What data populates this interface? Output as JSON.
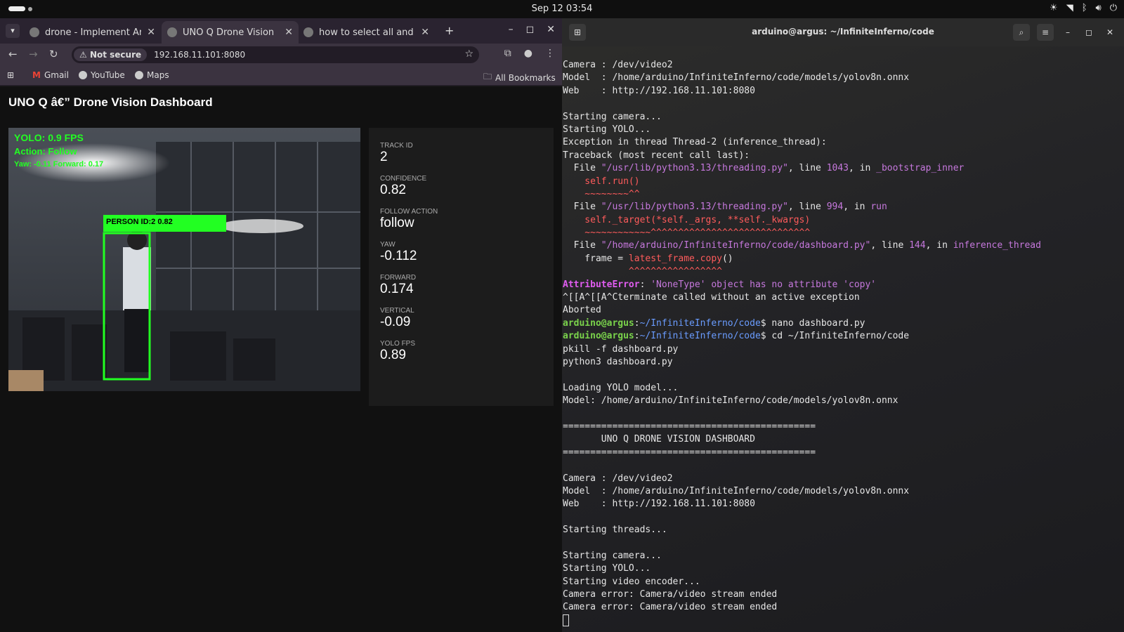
{
  "system": {
    "clock": "Sep 12  03:54"
  },
  "browser": {
    "tabs": [
      {
        "title": "drone - Implement Ardui",
        "active": false
      },
      {
        "title": "UNO Q Drone Vision",
        "active": true
      },
      {
        "title": "how to select all and del",
        "active": false
      }
    ],
    "security_label": "Not secure",
    "url": "192.168.11.101:8080",
    "bookmarks": [
      "Gmail",
      "YouTube",
      "Maps"
    ],
    "all_bookmarks": "All Bookmarks"
  },
  "dashboard": {
    "title": "UNO Q â€” Drone Vision Dashboard",
    "overlay": {
      "fps": "YOLO: 0.9 FPS",
      "action": "Action: Follow",
      "yaw_forward": "Yaw: -0.11  Forward: 0.17",
      "detection_label": "PERSON  ID:2  0.82"
    },
    "stats": [
      {
        "label": "TRACK ID",
        "value": "2"
      },
      {
        "label": "CONFIDENCE",
        "value": "0.82"
      },
      {
        "label": "FOLLOW ACTION",
        "value": "follow"
      },
      {
        "label": "YAW",
        "value": "-0.112"
      },
      {
        "label": "FORWARD",
        "value": "0.174"
      },
      {
        "label": "VERTICAL",
        "value": "-0.09"
      },
      {
        "label": "YOLO FPS",
        "value": "0.89"
      }
    ]
  },
  "terminal": {
    "title": "arduino@argus: ~/InfiniteInferno/code",
    "lines": [
      {
        "segments": [
          {
            "text": "Camera : /dev/video2"
          }
        ]
      },
      {
        "segments": [
          {
            "text": "Model  : /home/arduino/InfiniteInferno/code/models/yolov8n.onnx"
          }
        ]
      },
      {
        "segments": [
          {
            "text": "Web    : http://192.168.11.101:8080"
          }
        ]
      },
      {
        "segments": [
          {
            "text": ""
          }
        ]
      },
      {
        "segments": [
          {
            "text": "Starting camera..."
          }
        ]
      },
      {
        "segments": [
          {
            "text": "Starting YOLO..."
          }
        ]
      },
      {
        "segments": [
          {
            "text": "Exception in thread Thread-2 (inference_thread):"
          }
        ]
      },
      {
        "segments": [
          {
            "text": "Traceback (most recent call last):"
          }
        ]
      },
      {
        "segments": [
          {
            "text": "  File "
          },
          {
            "text": "\"/usr/lib/python3.13/threading.py\"",
            "cls": "mag"
          },
          {
            "text": ", line "
          },
          {
            "text": "1043",
            "cls": "mag"
          },
          {
            "text": ", in "
          },
          {
            "text": "_bootstrap_inner",
            "cls": "mag"
          }
        ]
      },
      {
        "segments": [
          {
            "text": "    self.run()",
            "cls": "red"
          }
        ]
      },
      {
        "segments": [
          {
            "text": "    ~~~~~~~~^^",
            "cls": "red"
          }
        ]
      },
      {
        "segments": [
          {
            "text": "  File "
          },
          {
            "text": "\"/usr/lib/python3.13/threading.py\"",
            "cls": "mag"
          },
          {
            "text": ", line "
          },
          {
            "text": "994",
            "cls": "mag"
          },
          {
            "text": ", in "
          },
          {
            "text": "run",
            "cls": "mag"
          }
        ]
      },
      {
        "segments": [
          {
            "text": "    self._target(*self._args, **self._kwargs)",
            "cls": "red"
          }
        ]
      },
      {
        "segments": [
          {
            "text": "    ~~~~~~~~~~~~^^^^^^^^^^^^^^^^^^^^^^^^^^^^^",
            "cls": "red"
          }
        ]
      },
      {
        "segments": [
          {
            "text": "  File "
          },
          {
            "text": "\"/home/arduino/InfiniteInferno/code/dashboard.py\"",
            "cls": "mag"
          },
          {
            "text": ", line "
          },
          {
            "text": "144",
            "cls": "mag"
          },
          {
            "text": ", in "
          },
          {
            "text": "inference_thread",
            "cls": "mag"
          }
        ]
      },
      {
        "segments": [
          {
            "text": "    frame = "
          },
          {
            "text": "latest_frame.copy",
            "cls": "red"
          },
          {
            "text": "()"
          }
        ]
      },
      {
        "segments": [
          {
            "text": "            ^^^^^^^^^^^^^^^^^",
            "cls": "red"
          }
        ]
      },
      {
        "segments": [
          {
            "text": "AttributeError",
            "cls": "err"
          },
          {
            "text": ": "
          },
          {
            "text": "'NoneType' object has no attribute 'copy'",
            "cls": "mag"
          }
        ]
      },
      {
        "segments": [
          {
            "text": "^[[A^[[A^Cterminate called without an active exception"
          }
        ]
      },
      {
        "segments": [
          {
            "text": "Aborted"
          }
        ]
      },
      {
        "segments": [
          {
            "text": "arduino@argus",
            "cls": "grn"
          },
          {
            "text": ":"
          },
          {
            "text": "~/InfiniteInferno/code",
            "cls": "blu"
          },
          {
            "text": "$ nano dashboard.py"
          }
        ]
      },
      {
        "segments": [
          {
            "text": "arduino@argus",
            "cls": "grn"
          },
          {
            "text": ":"
          },
          {
            "text": "~/InfiniteInferno/code",
            "cls": "blu"
          },
          {
            "text": "$ cd ~/InfiniteInferno/code"
          }
        ]
      },
      {
        "segments": [
          {
            "text": "pkill -f dashboard.py"
          }
        ]
      },
      {
        "segments": [
          {
            "text": "python3 dashboard.py"
          }
        ]
      },
      {
        "segments": [
          {
            "text": ""
          }
        ]
      },
      {
        "segments": [
          {
            "text": "Loading YOLO model..."
          }
        ]
      },
      {
        "segments": [
          {
            "text": "Model: /home/arduino/InfiniteInferno/code/models/yolov8n.onnx"
          }
        ]
      },
      {
        "segments": [
          {
            "text": ""
          }
        ]
      },
      {
        "segments": [
          {
            "text": "=============================================="
          }
        ]
      },
      {
        "segments": [
          {
            "text": "       UNO Q DRONE VISION DASHBOARD"
          }
        ]
      },
      {
        "segments": [
          {
            "text": "=============================================="
          }
        ]
      },
      {
        "segments": [
          {
            "text": ""
          }
        ]
      },
      {
        "segments": [
          {
            "text": "Camera : /dev/video2"
          }
        ]
      },
      {
        "segments": [
          {
            "text": "Model  : /home/arduino/InfiniteInferno/code/models/yolov8n.onnx"
          }
        ]
      },
      {
        "segments": [
          {
            "text": "Web    : http://192.168.11.101:8080"
          }
        ]
      },
      {
        "segments": [
          {
            "text": ""
          }
        ]
      },
      {
        "segments": [
          {
            "text": "Starting threads..."
          }
        ]
      },
      {
        "segments": [
          {
            "text": ""
          }
        ]
      },
      {
        "segments": [
          {
            "text": "Starting camera..."
          }
        ]
      },
      {
        "segments": [
          {
            "text": "Starting YOLO..."
          }
        ]
      },
      {
        "segments": [
          {
            "text": "Starting video encoder..."
          }
        ]
      },
      {
        "segments": [
          {
            "text": "Camera error: Camera/video stream ended"
          }
        ]
      },
      {
        "segments": [
          {
            "text": "Camera error: Camera/video stream ended"
          }
        ]
      }
    ]
  }
}
